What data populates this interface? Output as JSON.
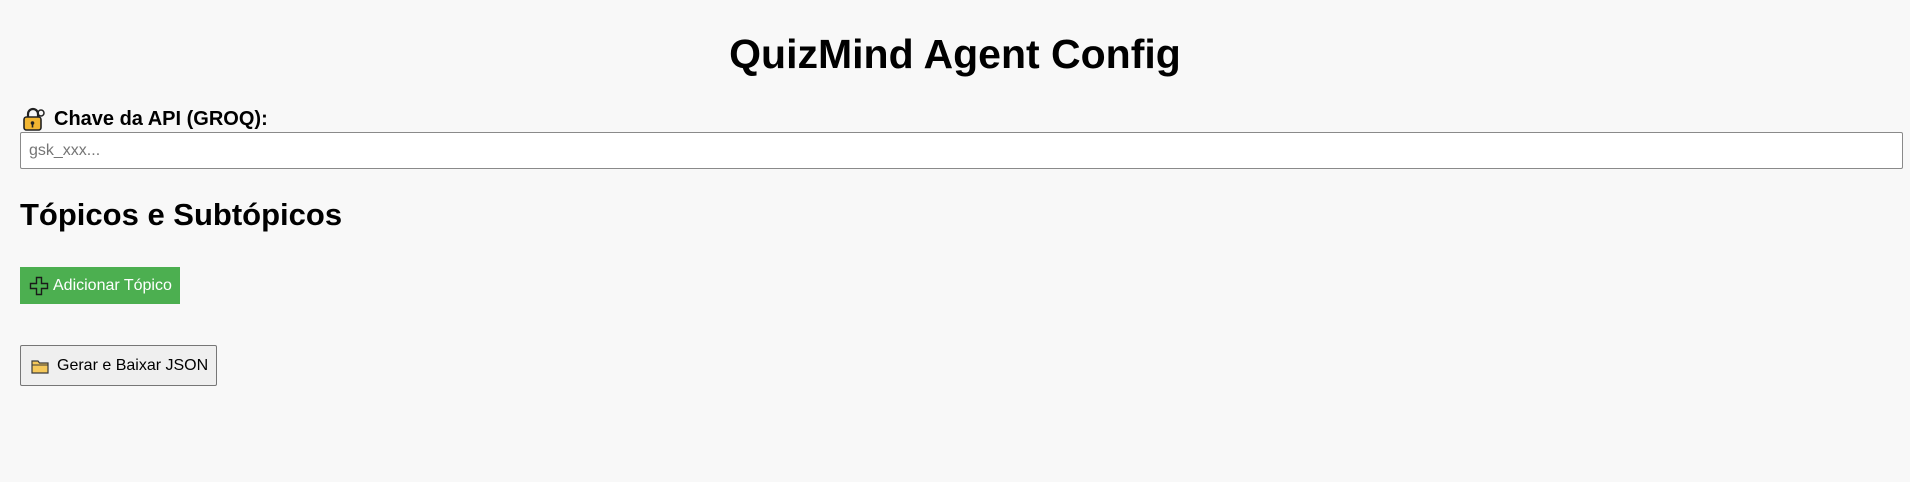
{
  "header": {
    "title": "QuizMind Agent Config"
  },
  "api_key": {
    "icon": "lock-key-icon",
    "label": "Chave da API (GROQ):",
    "value": "",
    "placeholder": "gsk_xxx..."
  },
  "topics": {
    "section_title": "Tópicos e Subtópicos",
    "add_button_icon": "plus-icon",
    "add_button_label": "Adicionar Tópico"
  },
  "export": {
    "button_icon": "folder-icon",
    "button_label": "Gerar e Baixar JSON"
  },
  "colors": {
    "page_background": "#f8f8f8",
    "add_button": "#4caf50",
    "add_button_text": "#ffffff",
    "folder_icon": "#f5c85a",
    "lock_icon": "#f2b632"
  }
}
